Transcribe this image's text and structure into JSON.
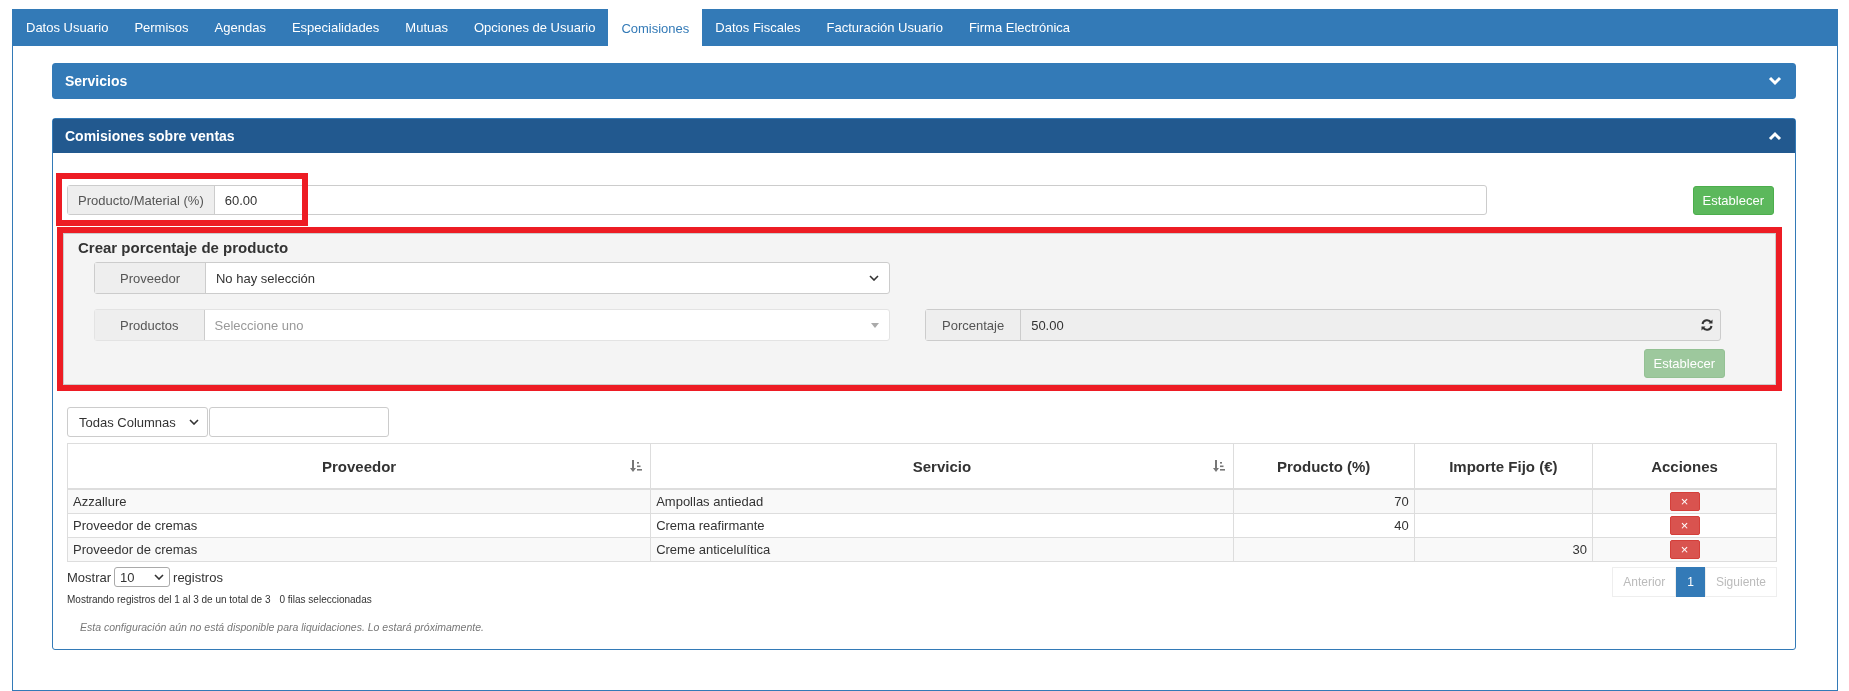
{
  "tabs": [
    {
      "label": "Datos Usuario",
      "selected": false
    },
    {
      "label": "Permisos",
      "selected": false
    },
    {
      "label": "Agendas",
      "selected": false
    },
    {
      "label": "Especialidades",
      "selected": false
    },
    {
      "label": "Mutuas",
      "selected": false
    },
    {
      "label": "Opciones de Usuario",
      "selected": false
    },
    {
      "label": "Comisiones",
      "selected": true
    },
    {
      "label": "Datos Fiscales",
      "selected": false
    },
    {
      "label": "Facturación Usuario",
      "selected": false
    },
    {
      "label": "Firma Electrónica",
      "selected": false
    }
  ],
  "panels": [
    {
      "title": "Servicios",
      "expanded": false
    },
    {
      "title": "Comisiones sobre ventas",
      "expanded": true
    }
  ],
  "general": {
    "label": "Producto/Material (%)",
    "value": "60.00",
    "button": {
      "label": "Establecer",
      "disabled": false
    }
  },
  "create": {
    "title": "Crear porcentaje de producto",
    "proveedor": {
      "label": "Proveedor",
      "value": "No hay selección"
    },
    "productos": {
      "label": "Productos",
      "placeholder": "Seleccione uno"
    },
    "porcentaje": {
      "label": "Porcentaje",
      "value": "50.00",
      "disabled": true
    },
    "button": {
      "label": "Establecer",
      "disabled": true
    }
  },
  "filter": {
    "column_select": "Todas Columnas"
  },
  "table": {
    "columns": [
      {
        "label": "Proveedor",
        "kind": "sorted"
      },
      {
        "label": "Servicio",
        "kind": "sorted"
      },
      {
        "label": "Producto (%)",
        "kind": "sortable"
      },
      {
        "label": "Importe Fijo (€)",
        "kind": "sortable"
      },
      {
        "label": "Acciones",
        "kind": "plain"
      }
    ],
    "rows": [
      [
        "Azzallure",
        "Ampollas antiedad",
        "70",
        ""
      ],
      [
        "Proveedor de cremas",
        "Crema reafirmante",
        "40",
        ""
      ],
      [
        "Proveedor de cremas",
        "Creme anticelulítica",
        "",
        "30"
      ]
    ],
    "delete_label": "×"
  },
  "footer": {
    "show_label": "Mostrar",
    "page_size": "10",
    "records_label": "registros",
    "info": "Mostrando registros del 1 al 3 de un total de 3",
    "selected_info": "0 filas seleccionadas",
    "pagination": [
      {
        "label": "Anterior",
        "selected": false
      },
      {
        "label": "1",
        "selected": true
      },
      {
        "label": "Siguiente",
        "selected": false
      }
    ],
    "note": "Esta configuración aún no está disponible para liquidaciones. Lo estará próximamente."
  }
}
